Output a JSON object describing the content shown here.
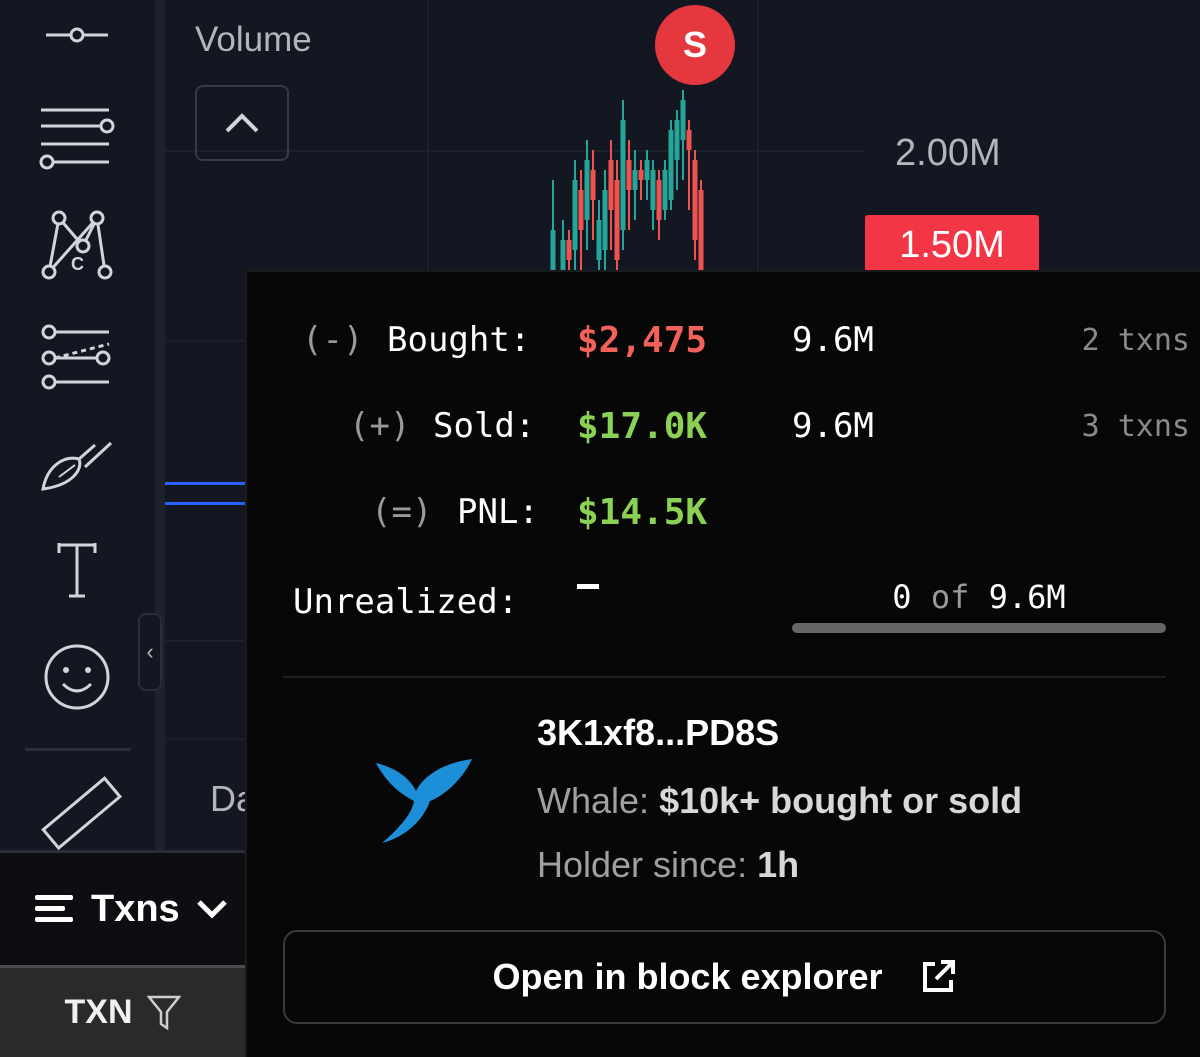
{
  "toolbar": {
    "tools": [
      {
        "name": "horizontal-line-icon"
      },
      {
        "name": "parallel-lines-icon"
      },
      {
        "name": "pattern-icon"
      },
      {
        "name": "forecast-icon"
      },
      {
        "name": "brush-icon"
      },
      {
        "name": "text-icon"
      },
      {
        "name": "emoji-icon"
      },
      {
        "name": "ruler-icon"
      }
    ],
    "collapse_glyph": "‹"
  },
  "chart": {
    "volume_label": "Volume",
    "axis_2m": "2.00M",
    "axis_current": "1.50M",
    "sell_marker": "S",
    "date_label": "Da",
    "colors": {
      "up": "#26a69a",
      "down": "#ef5350",
      "marker": "#e4383e",
      "price_tag": "#f23645"
    }
  },
  "txns_panel": {
    "label": "Txns",
    "header": "TXN"
  },
  "popover": {
    "bought": {
      "prefix": "(-)",
      "label": "Bought:",
      "amount": "$2,475",
      "tokens": "9.6M",
      "txns": "2 txns"
    },
    "sold": {
      "prefix": "(+)",
      "label": "Sold:",
      "amount": "$17.0K",
      "tokens": "9.6M",
      "txns": "3 txns"
    },
    "pnl": {
      "prefix": "(=)",
      "label": "PNL:",
      "amount": "$14.5K"
    },
    "unrealized": {
      "label": "Unrealized:",
      "held": "0",
      "of": "of",
      "total": "9.6M",
      "held_fraction": 0
    },
    "wallet": {
      "address": "3K1xf8...PD8S",
      "whale_label": "Whale:",
      "whale_desc": "$10k+ bought or sold",
      "holder_label": "Holder since:",
      "holder_value": "1h"
    },
    "explorer_button": "Open in block explorer",
    "colors": {
      "loss": "#f2615a",
      "gain": "#8bd254",
      "whale": "#1d8fd8"
    }
  }
}
